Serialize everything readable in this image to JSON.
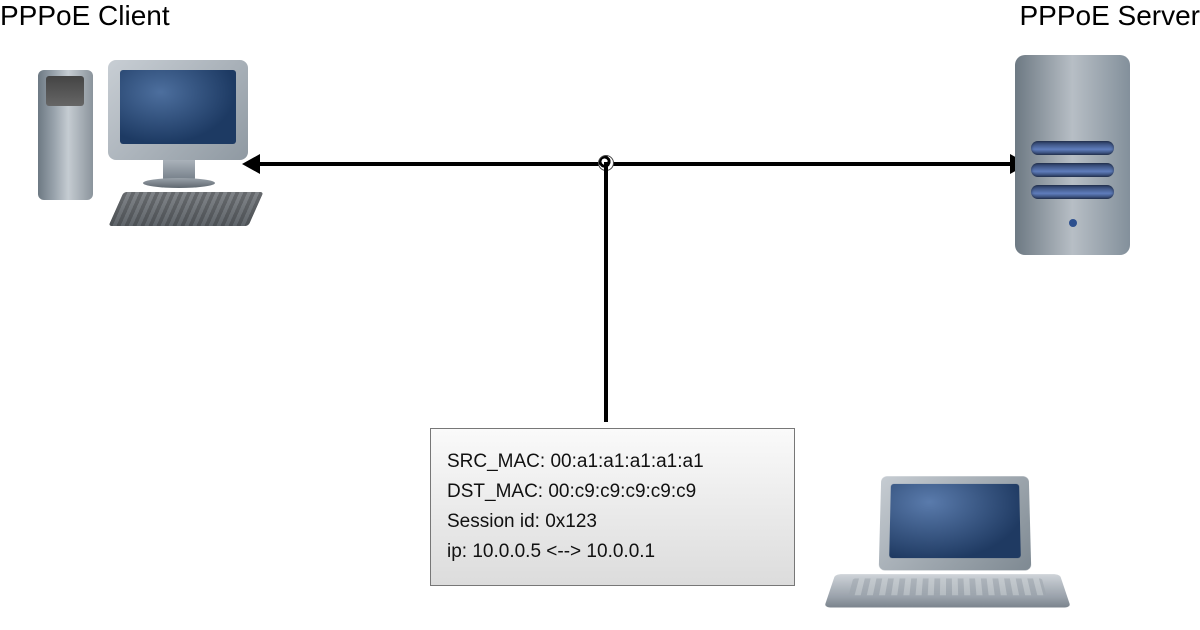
{
  "labels": {
    "client": "PPPoE Client",
    "server": "PPPoE Server"
  },
  "packet_info": {
    "src_mac_key": "SRC_MAC:",
    "src_mac_val": "00:a1:a1:a1:a1:a1",
    "dst_mac_key": "DST_MAC:",
    "dst_mac_val": "00:c9:c9:c9:c9:c9",
    "session_key": "Session id:",
    "session_val": "0x123",
    "ip_key": "ip:",
    "ip_val": "10.0.0.5 <--> 10.0.0.1"
  }
}
